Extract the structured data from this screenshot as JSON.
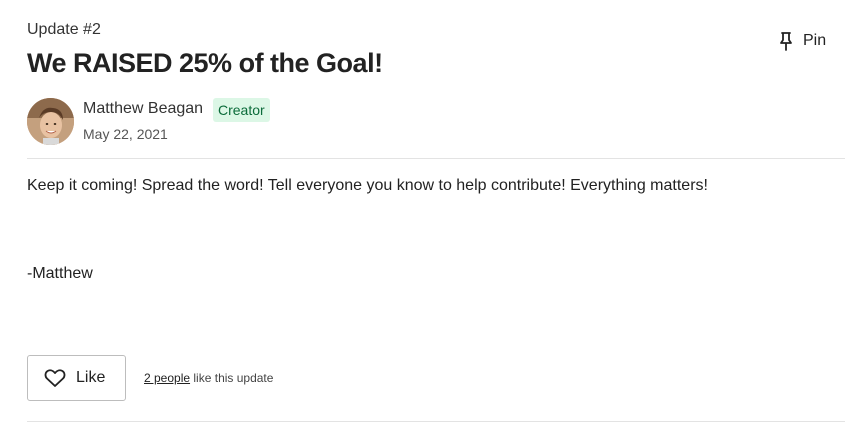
{
  "update": {
    "label": "Update #2",
    "title": "We RAISED 25% of the Goal!",
    "pin_label": "Pin"
  },
  "author": {
    "name": "Matthew Beagan",
    "badge": "Creator",
    "date": "May 22, 2021"
  },
  "body": {
    "paragraph": "Keep it coming! Spread the word! Tell everyone you know to help contribute! Everything matters!",
    "signoff": "-Matthew"
  },
  "likes": {
    "button_label": "Like",
    "count_link": "2 people",
    "suffix": "like this update"
  },
  "icons": {
    "pin": "pin-icon",
    "heart": "heart-icon"
  },
  "colors": {
    "badge_background": "#dcf7e6",
    "badge_text": "#0b6b3a",
    "divider": "#e3e3e3"
  }
}
